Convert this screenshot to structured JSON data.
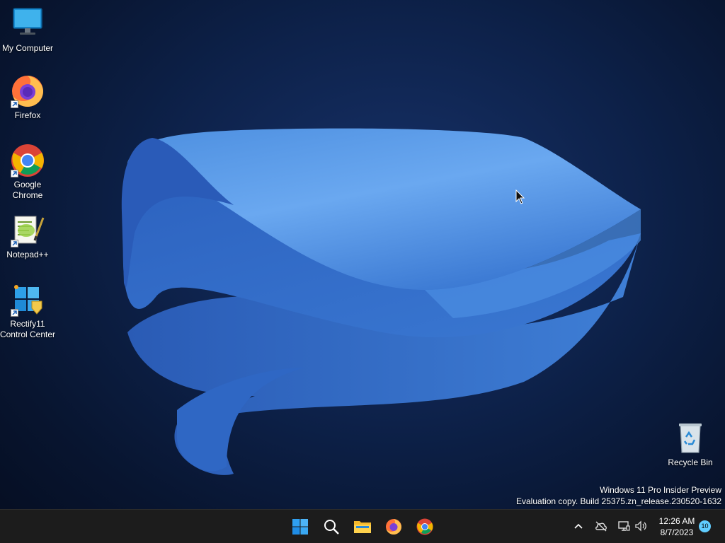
{
  "desktop": {
    "icons": [
      {
        "label": "My Computer",
        "icon": "monitor-icon"
      },
      {
        "label": "Firefox",
        "icon": "firefox-icon"
      },
      {
        "label": "Google Chrome",
        "icon": "chrome-icon"
      },
      {
        "label": "Notepad++",
        "icon": "notepad-plus-plus-icon"
      },
      {
        "label": "Rectify11 Control Center",
        "icon": "rectify11-icon"
      },
      {
        "label": "Recycle Bin",
        "icon": "recycle-bin-icon"
      }
    ],
    "watermark": {
      "line1": "Windows 11 Pro Insider Preview",
      "line2": "Evaluation copy. Build 25375.zn_release.230520-1632"
    }
  },
  "taskbar": {
    "pinned": [
      {
        "name": "Start",
        "icon": "windows-start-icon"
      },
      {
        "name": "Search",
        "icon": "search-icon"
      },
      {
        "name": "File Explorer",
        "icon": "folder-icon"
      },
      {
        "name": "Firefox",
        "icon": "firefox-icon"
      },
      {
        "name": "Google Chrome",
        "icon": "chrome-icon"
      }
    ],
    "tray": {
      "icons": [
        "chevron-up-icon",
        "cloud-offline-icon",
        "network-icon",
        "volume-icon"
      ],
      "time": "12:26 AM",
      "date": "8/7/2023",
      "notification_count": "10"
    }
  },
  "colors": {
    "accent": "#60cdff",
    "taskbar": "#1c1c1c",
    "wallpaper_bloom": "#3a7bd5"
  }
}
